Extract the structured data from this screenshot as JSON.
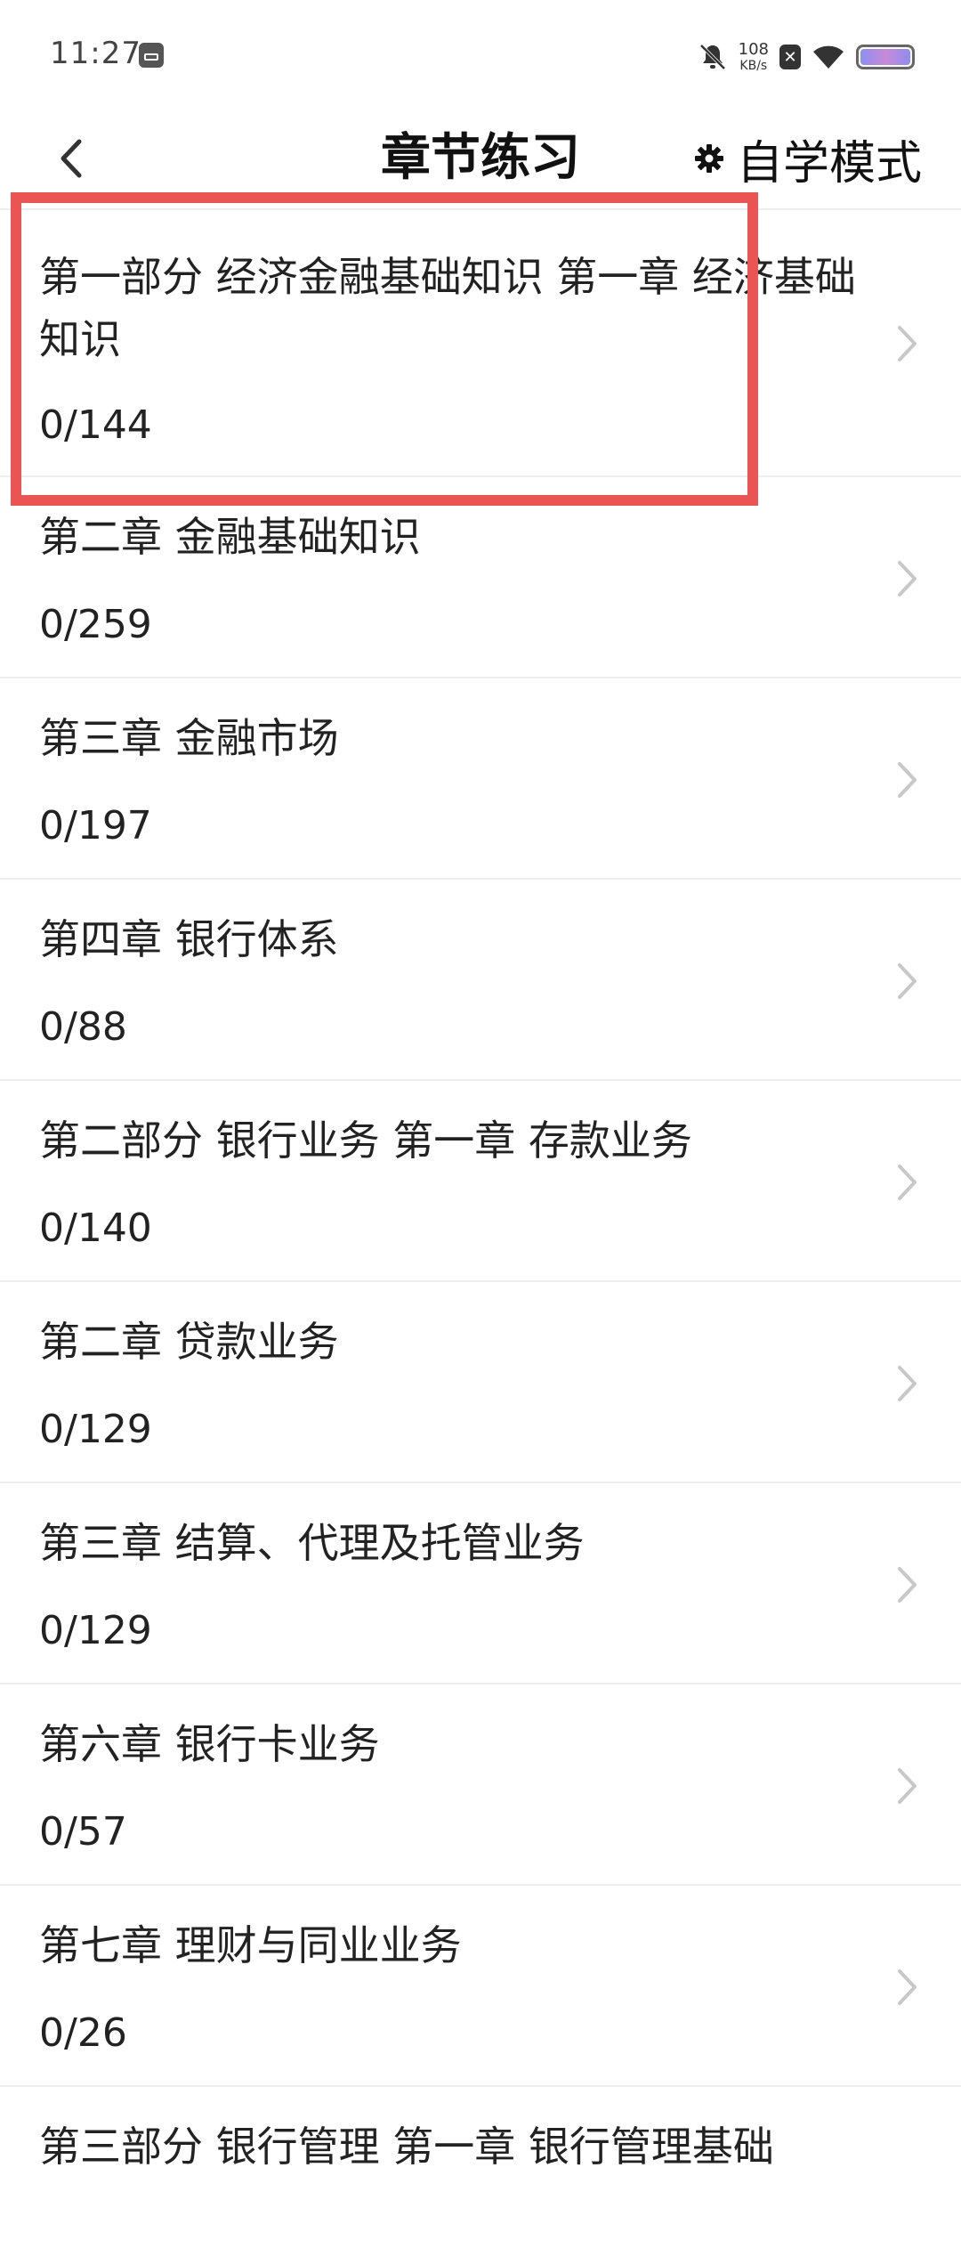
{
  "status_bar": {
    "time": "11:27",
    "net_speed_value": "108",
    "net_speed_unit": "KB/s",
    "x_badge": "✕"
  },
  "header": {
    "title": "章节练习",
    "mode_label": "自学模式",
    "back_icon": "chevron-left-icon",
    "mode_icon": "gear-icon"
  },
  "chapters": [
    {
      "title": "第一部分 经济金融基础知识 第一章 经济基础知识",
      "progress": "0/144"
    },
    {
      "title": "第二章 金融基础知识",
      "progress": "0/259"
    },
    {
      "title": "第三章 金融市场",
      "progress": "0/197"
    },
    {
      "title": "第四章 银行体系",
      "progress": "0/88"
    },
    {
      "title": "第二部分 银行业务  第一章 存款业务",
      "progress": "0/140"
    },
    {
      "title": "第二章 贷款业务",
      "progress": "0/129"
    },
    {
      "title": "第三章 结算、代理及托管业务",
      "progress": "0/129"
    },
    {
      "title": "第六章 银行卡业务",
      "progress": "0/57"
    },
    {
      "title": "第七章 理财与同业业务",
      "progress": "0/26"
    },
    {
      "title": "第三部分 银行管理 第一章 银行管理基础",
      "progress": ""
    }
  ],
  "colors": {
    "highlight": "#ea5554",
    "divider": "#eeeeee",
    "chevron": "#c8c8c8"
  }
}
